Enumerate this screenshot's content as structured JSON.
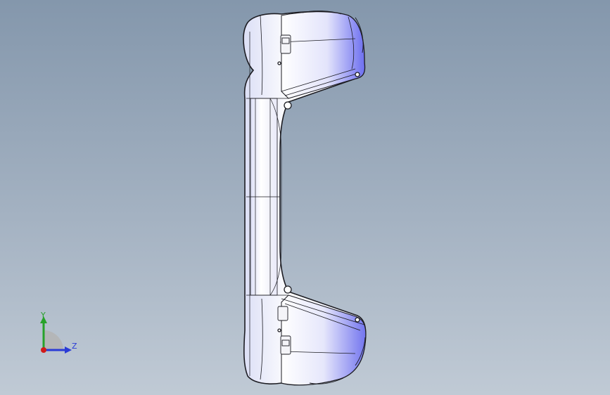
{
  "viewport": {
    "background_top": "#8497ac",
    "background_bottom": "#c0cad5"
  },
  "model": {
    "part_fill": "#f1f3fb",
    "part_shade": "#6d6ff0",
    "edge_color": "#1c1c22"
  },
  "triad": {
    "y_label": "Y",
    "z_label": "Z",
    "y_color": "#27a22a",
    "z_color": "#2a3bd6",
    "x_color": "#d11a1a"
  }
}
